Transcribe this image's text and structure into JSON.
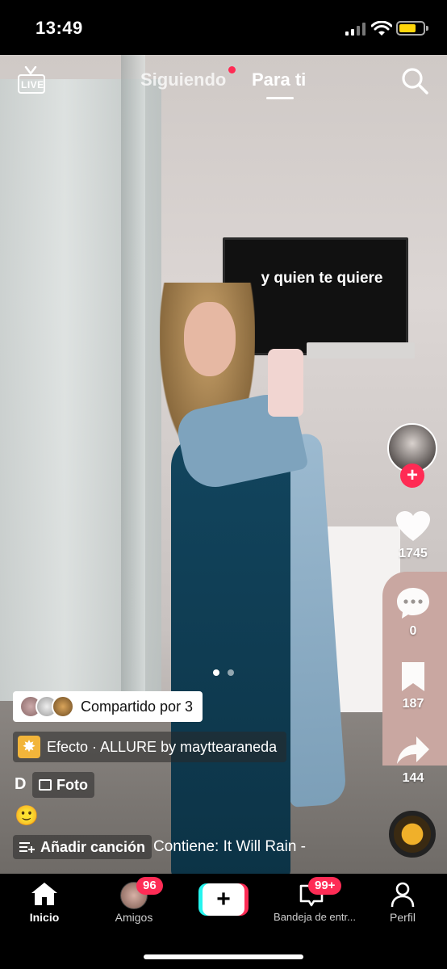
{
  "status_bar": {
    "time": "13:49",
    "battery_color": "#ffd60a"
  },
  "top_nav": {
    "live_label": "LIVE",
    "tabs": [
      {
        "label": "Siguiendo",
        "active": false,
        "has_dot": true
      },
      {
        "label": "Para ti",
        "active": true
      }
    ],
    "search_icon": "search-icon"
  },
  "video": {
    "caption": "y quien te quiere",
    "carousel_dots": 2,
    "carousel_active": 1
  },
  "right_rail": {
    "like_count": "1745",
    "comment_count": "0",
    "save_count": "187",
    "share_count": "144"
  },
  "info": {
    "shared_by": "Compartido por 3",
    "effect": "Efecto · ALLURE by maytte­araneda",
    "author_initial": "D",
    "photo_label": "Foto",
    "emoji": "🙂",
    "add_song": "Añadir canción",
    "song_text": "Contiene: It Will Rain -"
  },
  "tab_bar": {
    "items": [
      {
        "label": "Inicio",
        "active": true
      },
      {
        "label": "Amigos",
        "badge": "96"
      },
      {
        "label": ""
      },
      {
        "label": "Bandeja de entr...",
        "badge": "99+"
      },
      {
        "label": "Perfil"
      }
    ]
  },
  "colors": {
    "accent": "#fe2c55",
    "cyan": "#25f4ee"
  }
}
